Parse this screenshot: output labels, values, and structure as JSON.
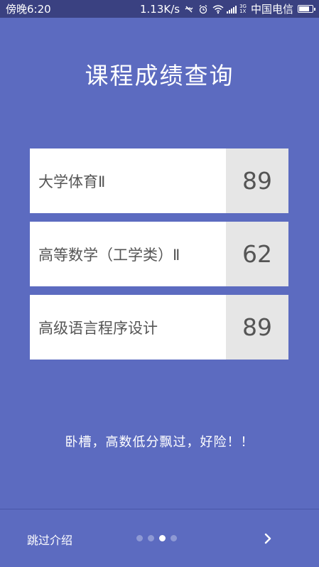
{
  "status_bar": {
    "time": "傍晚6:20",
    "speed": "1.13K/s",
    "network_top": "3G",
    "network_bottom": "1X",
    "carrier": "中国电信",
    "battery_level": 0.85
  },
  "title": "课程成绩查询",
  "courses": [
    {
      "name": "大学体育Ⅱ",
      "score": "89"
    },
    {
      "name": "高等数学（工学类）Ⅱ",
      "score": "62"
    },
    {
      "name": "高级语言程序设计",
      "score": "89"
    }
  ],
  "comment": "卧槽，高数低分飘过，好险！！",
  "footer": {
    "skip_label": "跳过介绍",
    "page_count": 4,
    "active_page": 3,
    "next_icon": "chevron-right-icon"
  },
  "colors": {
    "background": "#5c6bc0",
    "status_bar": "#3a4181",
    "score_cell": "#e6e6e6",
    "text_dark": "#555555"
  }
}
